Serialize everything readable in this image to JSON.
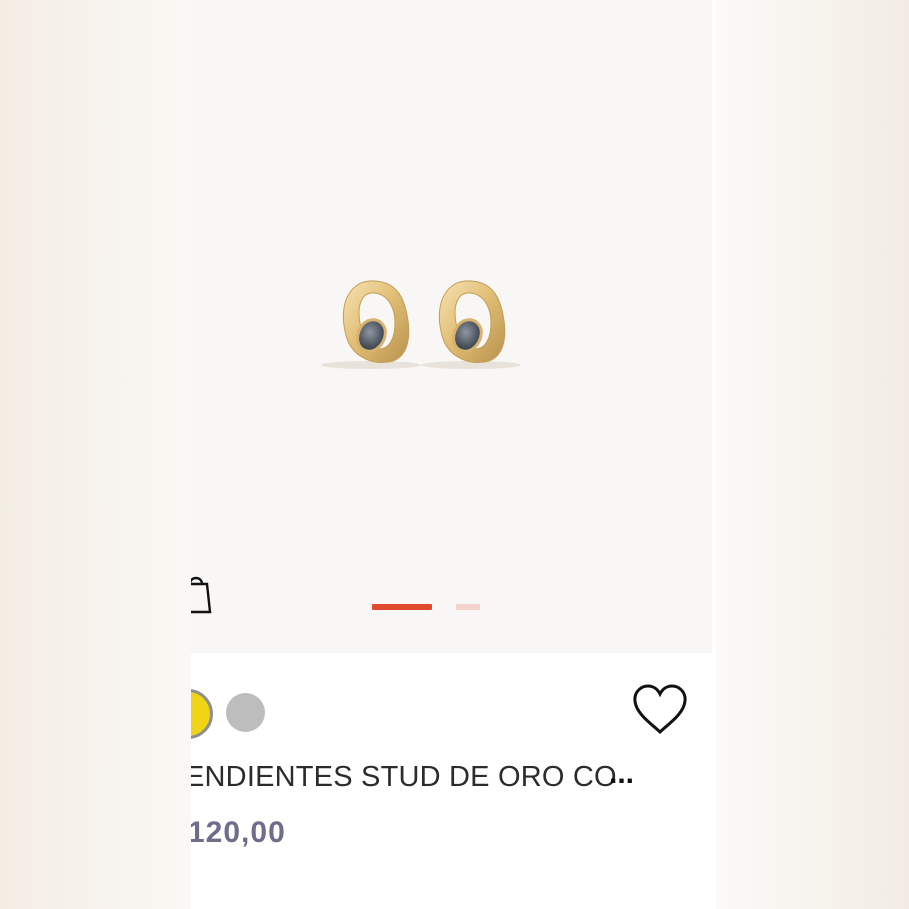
{
  "product": {
    "name": "ENDIENTES STUD DE ORO CO",
    "name_ellipsis": "...",
    "price": "120,00",
    "image_alt": "earrings"
  },
  "gallery": {
    "total_slides": 2,
    "active_slide": 1,
    "active_color": "#e14b2b",
    "inactive_color": "#f5d3cc"
  },
  "colors": {
    "options": [
      {
        "name": "gold",
        "hex": "#f2d417",
        "selected": true
      },
      {
        "name": "silver",
        "hex": "#bdbdbd",
        "selected": false
      }
    ]
  },
  "icons": {
    "cart": "shopping-bag-icon",
    "wishlist": "heart-icon"
  }
}
